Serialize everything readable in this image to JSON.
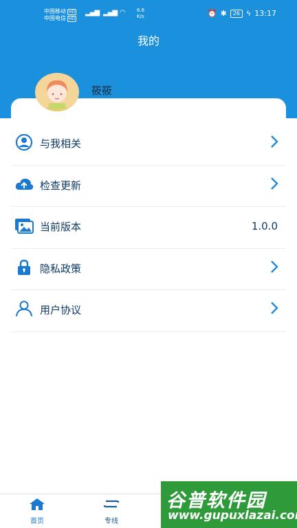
{
  "status_bar": {
    "carrier1": "中国移动",
    "carrier2": "中国电信",
    "hd": "HD",
    "speed_value": "6.6",
    "speed_unit": "K/s",
    "battery": "26",
    "time": "13:17"
  },
  "header": {
    "title": "我的"
  },
  "profile": {
    "username": "筱筱"
  },
  "menu": {
    "items": [
      {
        "label": "与我相关",
        "icon": "user-circle-icon"
      },
      {
        "label": "检查更新",
        "icon": "cloud-upload-icon"
      },
      {
        "label": "当前版本",
        "icon": "images-icon",
        "value": "1.0.0"
      },
      {
        "label": "隐私政策",
        "icon": "lock-icon"
      },
      {
        "label": "用户协议",
        "icon": "user-icon"
      }
    ]
  },
  "tabbar": {
    "tabs": [
      {
        "label": "首页",
        "icon": "home-icon",
        "active": true
      },
      {
        "label": "专线",
        "icon": "route-icon",
        "active": false
      }
    ]
  },
  "watermark": {
    "text": "谷普软件园",
    "url": "www.gupuxlazai.com"
  },
  "colors": {
    "brand": "#1b90dd",
    "text": "#0e3a66",
    "watermark": "#2f9a3a"
  }
}
